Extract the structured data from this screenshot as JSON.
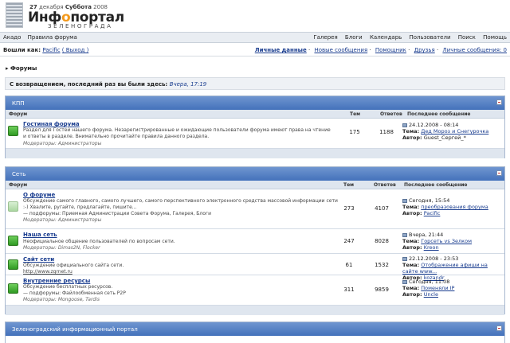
{
  "header": {
    "date_day": "27",
    "date_rest": "декабря",
    "weekday": "Суббота",
    "year": "2008",
    "title_pre": "Инф",
    "title_o": "о",
    "title_post": "портал",
    "subtitle": "ЗЕЛЕНОГРАДА"
  },
  "navbar": {
    "left": [
      "Акадо",
      "Правила форума"
    ],
    "right": [
      "Галерея",
      "Блоги",
      "Календарь",
      "Пользователи",
      "Поиск",
      "Помощь"
    ]
  },
  "userbar": {
    "logged_as": "Вошли как:",
    "user": "Pacific",
    "logout": "( Выход )",
    "links": [
      "Личные данные",
      "Новые сообщения",
      "Помощник",
      "Друзья",
      "Личные сообщения: 0"
    ]
  },
  "breadcrumb": "Форумы",
  "welcome": {
    "text": "С возвращением, последний раз вы были здесь:",
    "when": "Вчера, 17:19"
  },
  "columns": {
    "forum": "Форум",
    "topics": "Тем",
    "replies": "Ответов",
    "last": "Последнее сообщение"
  },
  "categories": [
    {
      "title": "КПП",
      "forums": [
        {
          "name": "Гостиная форума",
          "desc": "Раздел для Гостей нашего форума. Незарегистрированные и ожидающие пользователи форума имеют права на чтение и ответы в разделе. Внимательно прочитайте правила данного раздела.",
          "mods": "Модераторы: Администраторы",
          "topics": "175",
          "replies": "1188",
          "last_date": "24.12.2008 - 08:14",
          "last_topic_label": "Тема:",
          "last_topic": "Дед Мороз и Снегурочка",
          "last_author_label": "Автор:",
          "last_author": "Guest_Сергей_*"
        }
      ]
    },
    {
      "title": "Сеть",
      "forums": [
        {
          "name": "О форуме",
          "desc": "Обсуждение самого главного, самого лучшего, самого перспективного электронного средства массовой информации сети :-) Хвалите, ругайте, предлагайте, пишите...",
          "subforums": "— подфорумы: Приемная Администрации Совета Форума, Галерея, Блоги",
          "mods": "Модераторы: Администраторы",
          "topics": "273",
          "replies": "4107",
          "last_date": "Сегодня, 15:54",
          "last_topic_label": "Тема:",
          "last_topic": "преобразования форума",
          "last_author_label": "Автор:",
          "last_author": "Pacific"
        },
        {
          "name": "Наша сеть",
          "desc": "Неофициальное общение пользователей по вопросам сети.",
          "mods": "Модераторы: Dimas2N, Flocker",
          "topics": "247",
          "replies": "8028",
          "last_date": "Вчера, 21:44",
          "last_topic_label": "Тема:",
          "last_topic": "Горсеть vs Зелком",
          "last_author_label": "Автор:",
          "last_author": "Kreon"
        },
        {
          "name": "Сайт сети",
          "desc": "Обсуждение официального сайта сети.",
          "mods": "http://www.zgrnet.ru",
          "topics": "61",
          "replies": "1532",
          "last_date": "22.12.2008 - 23:53",
          "last_topic_label": "Тема:",
          "last_topic": "Отображение афиши на сайте www...",
          "last_author_label": "Автор:",
          "last_author": "kozandr"
        },
        {
          "name": "Внутренние ресурсы",
          "desc": "Обсуждение бесплатных ресурсов.",
          "subforums": "— подфорумы: Файлообменная сеть P2P",
          "mods": "Модераторы: Mongoose, Tardis",
          "topics": "311",
          "replies": "9859",
          "last_date": "Сегодня, 11:08",
          "last_topic_label": "Тема:",
          "last_topic": "Поменяли IP",
          "last_author_label": "Автор:",
          "last_author": "Uncle"
        }
      ]
    },
    {
      "title": "Зеленоградский информационный портал",
      "forums": []
    }
  ]
}
